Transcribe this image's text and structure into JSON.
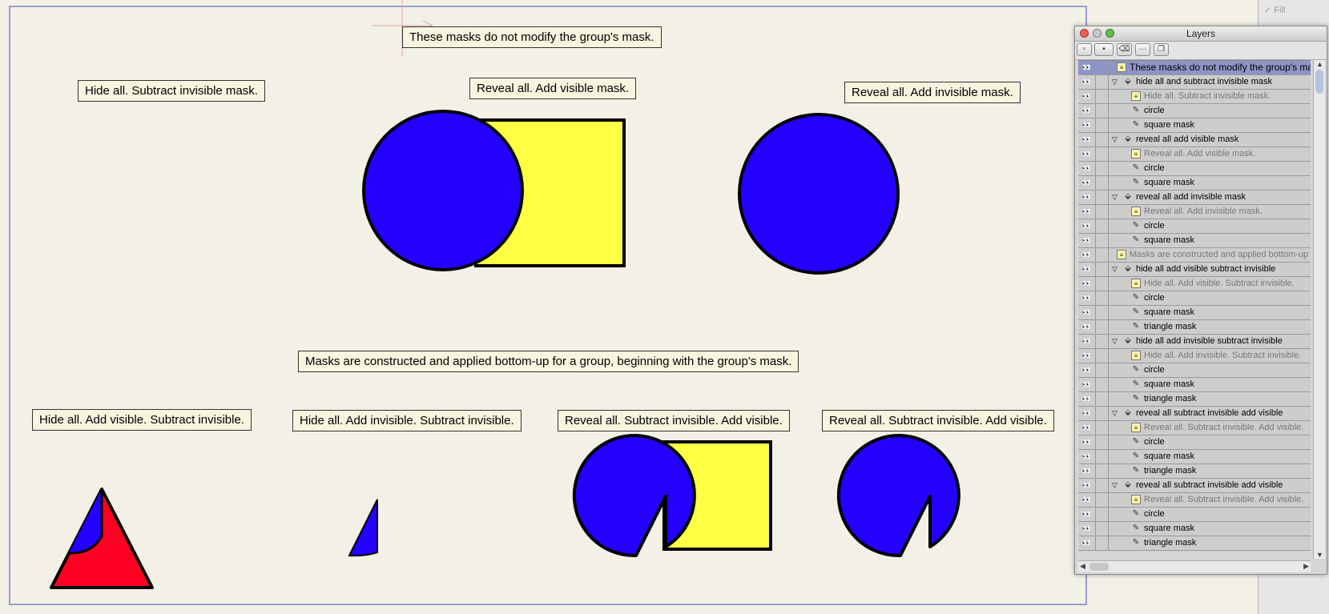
{
  "canvas": {
    "notes": {
      "top": "These masks do not modify the group's mask.",
      "hide_subtract": "Hide all. Subtract invisible mask.",
      "reveal_add_visible": "Reveal all. Add visible mask.",
      "reveal_add_invisible": "Reveal all. Add invisible mask.",
      "bottom_up": "Masks are constructed and applied bottom-up for a group, beginning with the group's mask.",
      "hide_add_vis_sub_invis": "Hide all. Add visible. Subtract invisible.",
      "hide_add_invis_sub_invis": "Hide all. Add invisible. Subtract invisible.",
      "reveal_sub_invis_add_vis_1": "Reveal all. Subtract invisible. Add visible.",
      "reveal_sub_invis_add_vis_2": "Reveal all. Subtract invisible. Add visible."
    },
    "colors": {
      "blue": "#2400ff",
      "yellow": "#ffff44",
      "red": "#ff0022"
    }
  },
  "layers_panel": {
    "title": "Layers",
    "toolbar": {
      "new_layer_icon": "new-layer-icon",
      "new_group_icon": "new-group-icon",
      "trash_icon": "trash-icon",
      "more_label": "···",
      "duplicate_icon": "duplicate-icon"
    },
    "rows": [
      {
        "label": "These masks do not modify the group's mask.",
        "kind": "note",
        "depth": 0,
        "selected": true
      },
      {
        "label": "hide all and subtract invisible mask",
        "kind": "group",
        "depth": 0
      },
      {
        "label": "Hide all. Subtract invisible mask.",
        "kind": "note",
        "depth": 1
      },
      {
        "label": "circle",
        "kind": "shape",
        "depth": 1
      },
      {
        "label": "square mask",
        "kind": "shape",
        "depth": 1
      },
      {
        "label": "reveal all add visible mask",
        "kind": "group",
        "depth": 0
      },
      {
        "label": "Reveal all. Add visible mask.",
        "kind": "note",
        "depth": 1
      },
      {
        "label": "circle",
        "kind": "shape",
        "depth": 1
      },
      {
        "label": "square mask",
        "kind": "shape",
        "depth": 1
      },
      {
        "label": "reveal all add invisible mask",
        "kind": "group",
        "depth": 0
      },
      {
        "label": "Reveal all. Add invisible mask.",
        "kind": "note",
        "depth": 1
      },
      {
        "label": "circle",
        "kind": "shape",
        "depth": 1
      },
      {
        "label": "square mask",
        "kind": "shape",
        "depth": 1
      },
      {
        "label": "Masks are constructed and applied bottom-up",
        "kind": "note",
        "depth": 0
      },
      {
        "label": "hide all add visible subtract invisible",
        "kind": "group",
        "depth": 0
      },
      {
        "label": "Hide all. Add visible. Subtract invisible.",
        "kind": "note",
        "depth": 1
      },
      {
        "label": "circle",
        "kind": "shape",
        "depth": 1
      },
      {
        "label": "square mask",
        "kind": "shape",
        "depth": 1
      },
      {
        "label": "triangle mask",
        "kind": "shape",
        "depth": 1
      },
      {
        "label": "hide all add invisible subtract invisible",
        "kind": "group",
        "depth": 0
      },
      {
        "label": "Hide all. Add invisible. Subtract invisible.",
        "kind": "note",
        "depth": 1
      },
      {
        "label": "circle",
        "kind": "shape",
        "depth": 1
      },
      {
        "label": "square mask",
        "kind": "shape",
        "depth": 1
      },
      {
        "label": "triangle mask",
        "kind": "shape",
        "depth": 1
      },
      {
        "label": "reveal all subtract invisible add visible",
        "kind": "group",
        "depth": 0
      },
      {
        "label": "Reveal all. Subtract invisible. Add visible.",
        "kind": "note",
        "depth": 1
      },
      {
        "label": "circle",
        "kind": "shape",
        "depth": 1
      },
      {
        "label": "square mask",
        "kind": "shape",
        "depth": 1
      },
      {
        "label": "triangle mask",
        "kind": "shape",
        "depth": 1
      },
      {
        "label": "reveal all subtract invisible add visible",
        "kind": "group",
        "depth": 0
      },
      {
        "label": "Reveal all. Subtract invisible. Add visible.",
        "kind": "note",
        "depth": 1
      },
      {
        "label": "circle",
        "kind": "shape",
        "depth": 1
      },
      {
        "label": "square mask",
        "kind": "shape",
        "depth": 1
      },
      {
        "label": "triangle mask",
        "kind": "shape",
        "depth": 1
      }
    ]
  },
  "side_strip": {
    "fill_label": "Fill"
  }
}
